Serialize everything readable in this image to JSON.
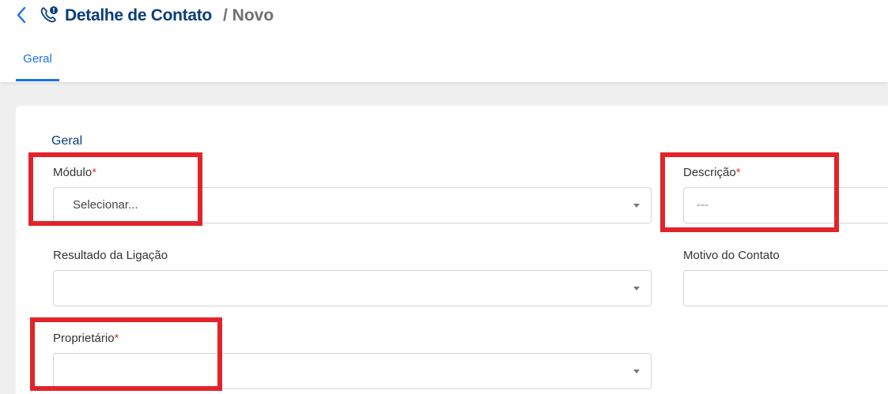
{
  "header": {
    "title": "Detalhe de Contato",
    "subtitle": "/ Novo"
  },
  "tabs": [
    {
      "label": "Geral",
      "active": true
    }
  ],
  "form": {
    "section_title": "Geral",
    "modulo": {
      "label": "Módulo",
      "required_mark": "*",
      "value": "Selecionar..."
    },
    "descricao": {
      "label": "Descrição",
      "required_mark": "*",
      "value": "---"
    },
    "resultado": {
      "label": "Resultado da Ligação",
      "value": ""
    },
    "motivo": {
      "label": "Motivo do Contato",
      "value": ""
    },
    "proprietario": {
      "label": "Proprietário",
      "required_mark": "*",
      "value": ""
    }
  },
  "colors": {
    "accent": "#1a73e8",
    "title": "#0a3d7a",
    "required": "#e53935",
    "annotation": "#e3232a"
  },
  "icons": {
    "back": "chevron-left-icon",
    "contact": "phone-alert-icon"
  }
}
